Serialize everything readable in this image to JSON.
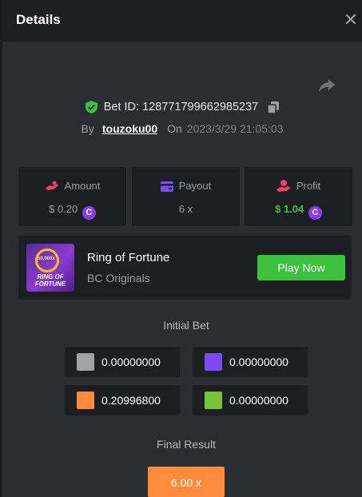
{
  "header": {
    "title": "Details"
  },
  "bet": {
    "label": "Bet ID: 128771799662985237",
    "by_label": "By",
    "user": "touzoku00",
    "on_label": "On",
    "date": "2023/3/29 21:05:03"
  },
  "stats": {
    "amount": {
      "label": "Amount",
      "value": "$ 0.20"
    },
    "payout": {
      "label": "Payout",
      "value": "6 x"
    },
    "profit": {
      "label": "Profit",
      "value": "$ 1.04"
    }
  },
  "game": {
    "name": "Ring of Fortune",
    "provider": "BC Originals",
    "thumb_line1": "RING OF",
    "thumb_line2": "FORTUNE",
    "thumb_number": "50,000x",
    "play_label": "Play Now"
  },
  "initial_bet": {
    "title": "Initial Bet",
    "tiles": [
      {
        "color": "#9ea3ab",
        "value": "0.00000000"
      },
      {
        "color": "#7b4cf5",
        "value": "0.00000000"
      },
      {
        "color": "#ff8b3d",
        "value": "0.20996800"
      },
      {
        "color": "#7ac23a",
        "value": "0.00000000"
      }
    ]
  },
  "final_result": {
    "title": "Final Result",
    "value": "6.00 x",
    "color": "#ff8b3d"
  },
  "colors": {
    "accent_green": "#3bc13b",
    "coin_purple": "#8a3cf0",
    "amount_pink": "#e8416e",
    "payout_purple": "#7b4cf5",
    "profit_red": "#e8416e"
  }
}
